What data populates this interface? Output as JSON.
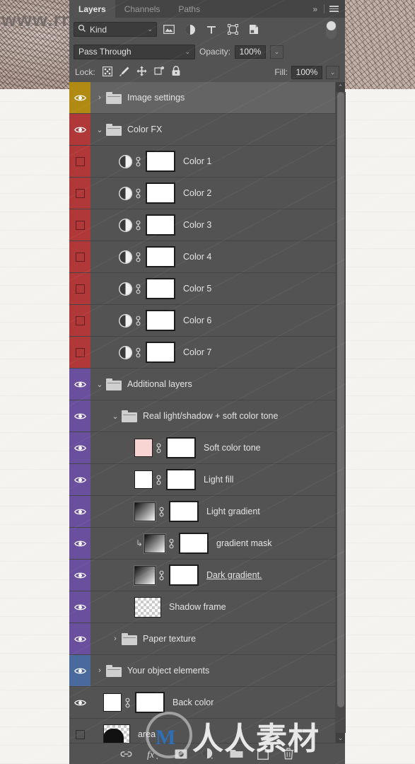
{
  "background": {
    "watermark_url": "www.rr-sc.com",
    "watermark_cn": "人人素材",
    "watermark_logo": "M"
  },
  "panel": {
    "tabs": [
      {
        "label": "Layers",
        "active": true
      },
      {
        "label": "Channels",
        "active": false
      },
      {
        "label": "Paths",
        "active": false
      }
    ],
    "overflow_label": "»",
    "menu_icon": "hamburger-menu-icon"
  },
  "filter": {
    "kind_label": "Kind",
    "search_icon": "search-icon",
    "chevron": "⌄",
    "icons": [
      "pixel-layer-filter-icon",
      "adjustment-layer-filter-icon",
      "type-layer-filter-icon",
      "shape-layer-filter-icon",
      "smart-object-filter-icon"
    ],
    "toggle_name": "filter-enable-toggle"
  },
  "blend": {
    "mode": "Pass Through",
    "chevron": "⌄",
    "opacity_label": "Opacity:",
    "opacity_value": "100%",
    "fill_label": "Fill:",
    "fill_value": "100%"
  },
  "lock": {
    "label": "Lock:",
    "icons": [
      "lock-transparent-pixels-icon",
      "lock-image-pixels-icon",
      "lock-position-icon",
      "lock-artboard-nesting-icon",
      "lock-all-icon"
    ]
  },
  "colors": {
    "label_olive": "#b08a12",
    "label_red": "#b03838",
    "label_purple": "#6a4f9e",
    "label_blue": "#4a6a9e",
    "panel_bg": "#535353",
    "row_selected": "#646464",
    "tab_bg": "#454545"
  },
  "layers": [
    {
      "name": "Image settings",
      "type": "group",
      "indent": 0,
      "visible": true,
      "label": "olive",
      "twisty": "collapsed",
      "selected": true
    },
    {
      "name": "Color FX",
      "type": "group",
      "indent": 0,
      "visible": true,
      "label": "red",
      "twisty": "expanded",
      "selected": false
    },
    {
      "name": "Color 1",
      "type": "adjustment",
      "indent": 1,
      "visible": false,
      "label": "red",
      "linked": true,
      "mask": true
    },
    {
      "name": "Color 2",
      "type": "adjustment",
      "indent": 1,
      "visible": false,
      "label": "red",
      "linked": true,
      "mask": true
    },
    {
      "name": "Color 3",
      "type": "adjustment",
      "indent": 1,
      "visible": false,
      "label": "red",
      "linked": true,
      "mask": true
    },
    {
      "name": "Color 4",
      "type": "adjustment",
      "indent": 1,
      "visible": false,
      "label": "red",
      "linked": true,
      "mask": true
    },
    {
      "name": "Color 5",
      "type": "adjustment",
      "indent": 1,
      "visible": false,
      "label": "red",
      "linked": true,
      "mask": true
    },
    {
      "name": "Color 6",
      "type": "adjustment",
      "indent": 1,
      "visible": false,
      "label": "red",
      "linked": true,
      "mask": true
    },
    {
      "name": "Color 7",
      "type": "adjustment",
      "indent": 1,
      "visible": false,
      "label": "red",
      "linked": true,
      "mask": true
    },
    {
      "name": "Additional layers",
      "type": "group",
      "indent": 0,
      "visible": true,
      "label": "purple",
      "twisty": "expanded"
    },
    {
      "name": "Real light/shadow + soft color tone",
      "type": "group",
      "indent": 1,
      "visible": true,
      "label": "purple",
      "twisty": "expanded"
    },
    {
      "name": "Soft color tone",
      "type": "fill-pink",
      "indent": 2,
      "visible": true,
      "label": "purple",
      "linked": true,
      "mask": true
    },
    {
      "name": "Light fill",
      "type": "fill-white",
      "indent": 2,
      "visible": true,
      "label": "purple",
      "linked": true,
      "mask": true
    },
    {
      "name": "Light gradient",
      "type": "gradient",
      "indent": 2,
      "visible": true,
      "label": "purple",
      "linked": true,
      "mask": true
    },
    {
      "name": "gradient mask",
      "type": "gradient",
      "indent": 2,
      "visible": true,
      "label": "purple",
      "linked": true,
      "mask": true,
      "clipped": true
    },
    {
      "name": "Dark gradient.",
      "type": "gradient",
      "indent": 2,
      "visible": true,
      "label": "purple",
      "linked": true,
      "mask": true,
      "underline": true
    },
    {
      "name": "Shadow frame",
      "type": "pixel",
      "indent": 2,
      "visible": true,
      "label": "purple"
    },
    {
      "name": "Paper texture",
      "type": "group",
      "indent": 1,
      "visible": true,
      "label": "purple",
      "twisty": "collapsed"
    },
    {
      "name": "Your object elements",
      "type": "group",
      "indent": 0,
      "visible": true,
      "label": "blue",
      "twisty": "collapsed"
    },
    {
      "name": "Back color",
      "type": "fill-white",
      "indent": 0,
      "visible": true,
      "label": "none",
      "linked": true,
      "mask": true
    },
    {
      "name": "area",
      "type": "area",
      "indent": 0,
      "visible": false,
      "label": "none"
    }
  ],
  "scrollbar": {
    "up_arrow": "⌃",
    "down_arrow": "⌄"
  },
  "bottom_toolbar": {
    "items": [
      {
        "icon": "link-layers-icon",
        "label": "Link layers"
      },
      {
        "icon": "layer-style-fx-icon",
        "label": "fx"
      },
      {
        "icon": "add-layer-mask-icon",
        "label": "Add layer mask"
      },
      {
        "icon": "new-adjustment-layer-icon",
        "label": "New adjustment layer"
      },
      {
        "icon": "new-group-icon",
        "label": "New group"
      },
      {
        "icon": "new-layer-icon",
        "label": "New layer"
      },
      {
        "icon": "delete-layer-icon",
        "label": "Delete layer"
      }
    ]
  }
}
